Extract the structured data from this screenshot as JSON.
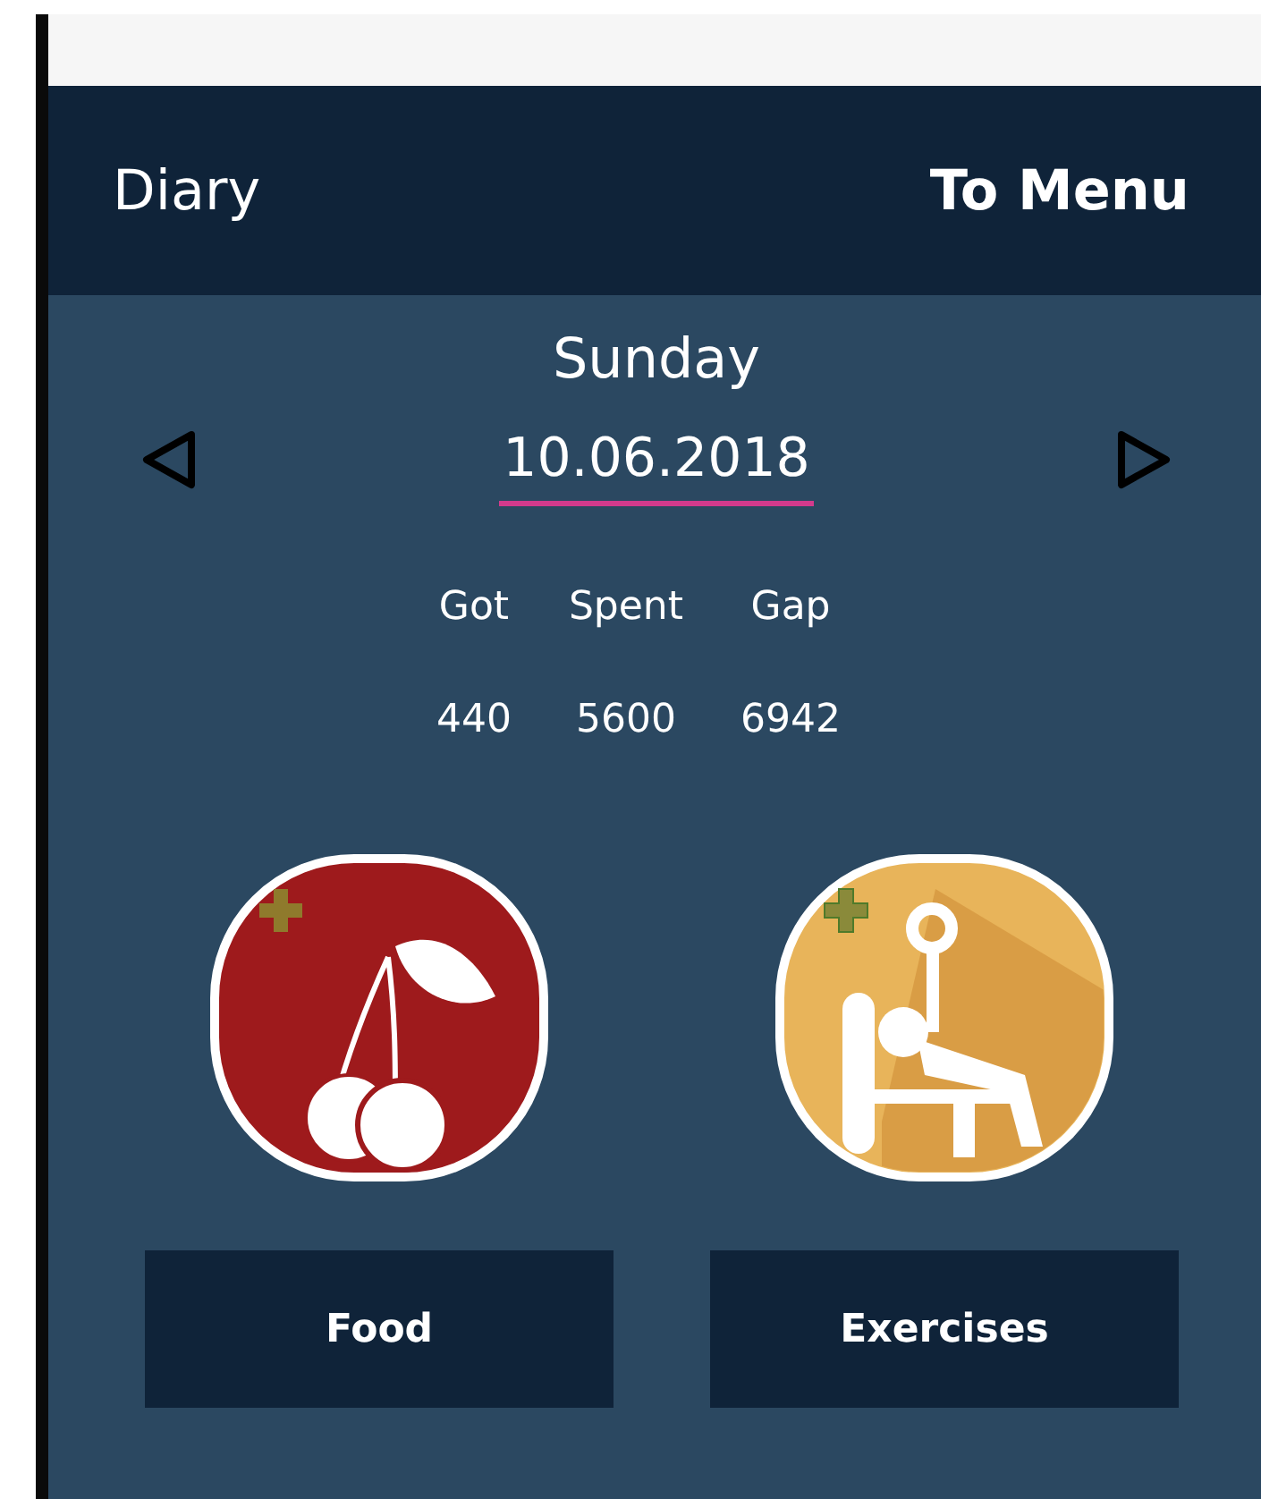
{
  "header": {
    "title": "Diary",
    "menu_link": "To Menu"
  },
  "date_picker": {
    "day": "Sunday",
    "date": "10.06.2018"
  },
  "stats": [
    {
      "label": "Got",
      "value": "440"
    },
    {
      "label": "Spent",
      "value": "5600"
    },
    {
      "label": "Gap",
      "value": "6942"
    }
  ],
  "actions": [
    {
      "kind": "food",
      "label": "Food"
    },
    {
      "kind": "exercise",
      "label": "Exercises"
    }
  ]
}
